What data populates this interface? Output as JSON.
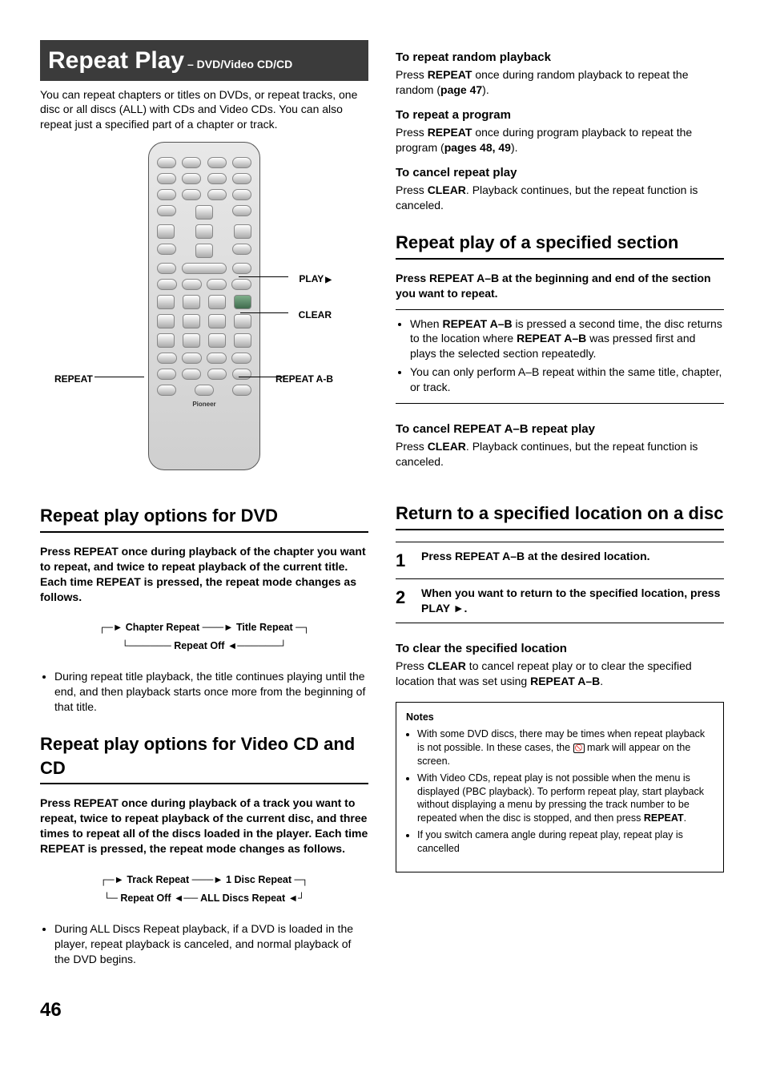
{
  "page_number": "46",
  "title": {
    "main": "Repeat Play",
    "sub": " – DVD/Video CD/CD"
  },
  "intro": "You can repeat chapters or titles on DVDs, or repeat tracks, one disc or all discs (ALL) with CDs and Video CDs. You can also repeat just a specified part of a chapter or track.",
  "remote_labels": {
    "repeat": "REPEAT",
    "play": "PLAY",
    "clear": "CLEAR",
    "repeat_ab": "REPEAT A-B"
  },
  "dvd": {
    "heading": "Repeat play options for DVD",
    "instruction": "Press REPEAT once during playback of the chapter you want to repeat, and twice to repeat playback of the current title. Each time REPEAT is pressed, the repeat mode changes as follows.",
    "cycle": [
      "Chapter Repeat",
      "Title Repeat",
      "Repeat Off"
    ],
    "bullet": "During repeat title playback, the title continues playing until the end, and then playback starts once more from the beginning of that title."
  },
  "vcd": {
    "heading": "Repeat play options for Video CD and CD",
    "instruction": "Press REPEAT once during playback of a track you want to repeat, twice to repeat playback of the current disc, and three times to repeat all of the discs loaded in the player. Each time REPEAT is pressed, the repeat mode changes as follows.",
    "cycle": [
      "Track Repeat",
      "1 Disc Repeat",
      "ALL Discs Repeat",
      "Repeat Off"
    ],
    "bullet": "During ALL Discs Repeat playback, if a DVD is loaded in the player, repeat playback is canceled, and normal playback of the DVD begins."
  },
  "random": {
    "heading": "To repeat random playback",
    "text_a": "Press ",
    "text_b": "REPEAT",
    "text_c": " once during random playback to repeat the random (",
    "text_d": "page 47",
    "text_e": ")."
  },
  "program": {
    "heading": "To repeat a program",
    "text_a": "Press ",
    "text_b": "REPEAT",
    "text_c": " once during program playback to repeat the program (",
    "text_d": "pages 48, 49",
    "text_e": ")."
  },
  "cancel": {
    "heading": "To cancel repeat play",
    "text_a": "Press ",
    "text_b": "CLEAR",
    "text_c": ". Playback continues, but the repeat function is canceled."
  },
  "section_ab": {
    "heading": "Repeat play of a specified section",
    "instruction": "Press REPEAT A–B at the beginning and end of the section you want to repeat.",
    "bullet1_a": "When ",
    "bullet1_b": "REPEAT A–B",
    "bullet1_c": " is pressed a second time, the disc returns to the location where ",
    "bullet1_d": "REPEAT A–B",
    "bullet1_e": " was pressed first and plays the selected section repeatedly.",
    "bullet2": "You can only perform A–B repeat within the same title, chapter, or track.",
    "cancel_heading": "To cancel REPEAT A–B repeat play",
    "cancel_a": "Press ",
    "cancel_b": "CLEAR",
    "cancel_c": ". Playback continues, but the repeat function is canceled."
  },
  "return_loc": {
    "heading": "Return to a specified location on a disc",
    "step1": "Press REPEAT A–B at the desired location.",
    "step2": "When you want to return to the specified location, press PLAY ►.",
    "clear_heading": "To clear the specified location",
    "clear_a": "Press ",
    "clear_b": "CLEAR",
    "clear_c": " to cancel repeat play or to clear the specified location that was set using ",
    "clear_d": "REPEAT A–B",
    "clear_e": "."
  },
  "notes": {
    "heading": "Notes",
    "n1_a": "With some DVD discs, there may be times when repeat playback is not possible. In these cases, the ",
    "n1_b": " mark will appear on the screen.",
    "n2_a": "With Video CDs, repeat play is not possible when the menu is displayed (PBC playback). To perform repeat play, start playback without displaying a menu by pressing the track number to be repeated when the disc is stopped, and then press ",
    "n2_b": "REPEAT",
    "n2_c": ".",
    "n3": "If you switch camera angle during repeat play, repeat play is cancelled"
  }
}
